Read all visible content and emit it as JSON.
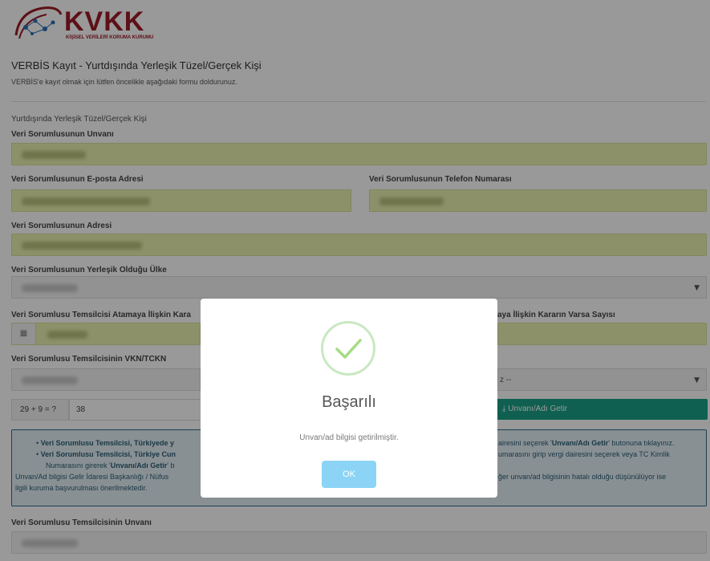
{
  "logo": {
    "text": "KVKK",
    "subtext": "KİŞİSEL VERİLERİ KORUMA KURUMU"
  },
  "header": {
    "title": "VERBİS Kayıt - Yurtdışında Yerleşik Tüzel/Gerçek Kişi",
    "subtitle": "VERBİS'e kayıt olmak için lütfen öncelikle aşağıdaki formu doldurunuz."
  },
  "form": {
    "section_title": "Yurtdışında Yerleşik Tüzel/Gerçek Kişi",
    "labels": {
      "unvan": "Veri Sorumlusunun Unvanı",
      "eposta": "Veri Sorumlusunun E-posta Adresi",
      "telefon": "Veri Sorumlusunun Telefon Numarası",
      "adres": "Veri Sorumlusunun Adresi",
      "ulke": "Veri Sorumlusunun Yerleşik Olduğu Ülke",
      "karar_tarih": "Veri Sorumlusu Temsilcisi Atamaya İlişkin Kara",
      "karar_sayi": "aya İlişkin Kararın Varsa Sayısı",
      "vkn": "Veri Sorumlusu Temsilcisinin VKN/TCKN",
      "temsilci_unvan": "Veri Sorumlusu Temsilcisinin Unvanı"
    },
    "vergi_dairesi_partial": "z --",
    "captcha_question": "29 + 9 = ?",
    "captcha_answer": "38",
    "get_button": "Unvanı/Adı Getir"
  },
  "info_box": {
    "line1_left": "Veri Sorumlusu Temsilcisi, Türkiyede y",
    "line1_right_pre": "airesini seçerek '",
    "line1_right_bold": "Unvanı/Adı Getir",
    "line1_right_post": "' butonuna tıklayınız.",
    "line2_left": "Veri Sorumlusu Temsilcisi, Türkiye Cun",
    "line2_right": "umarasını girip vergi dairesini seçerek veya TC Kimlik",
    "line3_left_pre": "Numarasını girerek '",
    "line3_left_bold": "Unvanı/Adı Getir",
    "line3_left_post": "' b",
    "line4_left": "Unvan/Ad bilgisi Gelir İdaresi Başkanlığı / Nüfus",
    "line4_right": "ğer unvan/ad bilgisinin hatalı olduğu düşünülüyor ise",
    "line5_left": "ilgili kuruma başvurulması önerilmektedir."
  },
  "modal": {
    "title": "Başarılı",
    "text": "Unvan/ad bilgisi getirilmiştir.",
    "ok_label": "OK"
  }
}
